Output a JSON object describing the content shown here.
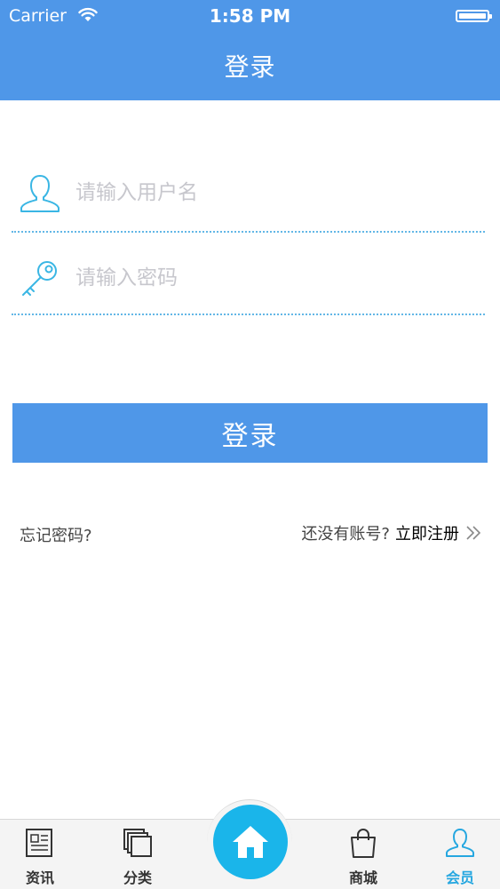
{
  "status": {
    "carrier": "Carrier",
    "time": "1:58 PM"
  },
  "nav": {
    "title": "登录"
  },
  "form": {
    "username": {
      "placeholder": "请输入用户名",
      "value": ""
    },
    "password": {
      "placeholder": "请输入密码",
      "value": ""
    },
    "login_label": "登录"
  },
  "links": {
    "forgot": "忘记密码?",
    "no_account": "还没有账号?",
    "register": "立即注册"
  },
  "tabs": [
    {
      "label": "资讯",
      "icon": "news-icon"
    },
    {
      "label": "分类",
      "icon": "category-icon"
    },
    {
      "label": "",
      "icon": "home-icon"
    },
    {
      "label": "商城",
      "icon": "shop-bag-icon"
    },
    {
      "label": "会员",
      "icon": "member-icon",
      "active": true
    }
  ],
  "colors": {
    "primary": "#4f97e8",
    "accent": "#26a7e0",
    "home": "#1ab5ea"
  }
}
